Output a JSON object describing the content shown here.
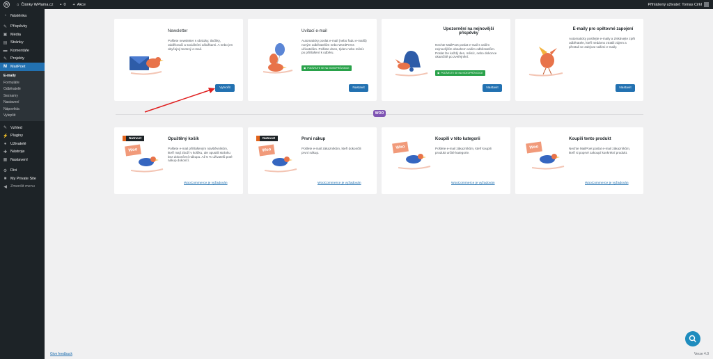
{
  "adminbar": {
    "site_name": "Články WPlama.cz",
    "comments_count": "0",
    "new_label": "Akce",
    "greeting": "Přihlášený uživatel: Tomas Cirkl"
  },
  "sidebar": {
    "items_top": [
      {
        "label": "Nástěnka",
        "icon": "dashboard-icon"
      },
      {
        "label": "Příspěvky",
        "icon": "pin-icon"
      },
      {
        "label": "Média",
        "icon": "media-icon"
      },
      {
        "label": "Stránky",
        "icon": "pages-icon"
      },
      {
        "label": "Komentáře",
        "icon": "comments-icon"
      },
      {
        "label": "Projekty",
        "icon": "pin-icon"
      },
      {
        "label": "MailPoet",
        "icon": "mailpoet-icon"
      }
    ],
    "submenu": [
      "E-maily",
      "Formuláře",
      "Odběratelé",
      "Seznamy",
      "Nastavení",
      "Nápověda",
      "Vylepšit"
    ],
    "items_bottom": [
      {
        "label": "Vzhled",
        "icon": "appearance-icon"
      },
      {
        "label": "Pluginy",
        "icon": "plugins-icon"
      },
      {
        "label": "Uživatelé",
        "icon": "users-icon"
      },
      {
        "label": "Nástroje",
        "icon": "tools-icon"
      },
      {
        "label": "Nastavení",
        "icon": "settings-icon"
      }
    ],
    "items_extra": [
      {
        "label": "Divi",
        "icon": "gear-icon"
      },
      {
        "label": "My Private Site",
        "icon": "lock-icon"
      },
      {
        "label": "Zmenšit menu",
        "icon": "collapse-icon"
      }
    ]
  },
  "cards_row1": [
    {
      "title": "Newsletter",
      "description": "Pošlete newsletter s obrázky, tlačítky, oddělovači a sociálními záložkami. A nebo jen obyčejný textový e-mail.",
      "button": "Vytvořit"
    },
    {
      "title": "Uvítací e-mail",
      "description": "Automaticky poslat e-mail (nebo řadu e-mailů) novým odběratelům nebo WordPress uživatelům. Pošlete dnes, týden nebo měsíc po přihlášení k odběru.",
      "guide": "PODÍVEJTE SE NA VIDEOPRŮVODCE",
      "button": "Nastavit"
    },
    {
      "title": "Upozornění na nejnovější příspěvky",
      "description": "Nechte MailPoet poslat e-mail s vaším nejnovějším obsahem vašim odběratelům. Poslat lze každý den, měsíc, nebo dokonce okamžitě po zveřejnění.",
      "guide": "PODÍVEJTE SE NA VIDEOPRŮVODCE",
      "button": "Nastavit"
    },
    {
      "title": "E-maily pro opětovné zapojení",
      "description": "Automaticky posílejte e-maily a získávejte zpět odběratele, kteří nedávno ztratili zájem a přestali se zabývat vašimi e-maily.",
      "button": "Nastavit"
    }
  ],
  "divider_badge": "WOO",
  "cards_row2": [
    {
      "badge": "Nutnost",
      "title": "Opuštěný košík",
      "description": "Pošlete e-mail přihlášeným návštěvníkům, kteří mají zboží v košíku, ale opustili stránku bez dokončení nákupu. Až 5 % uživatelů poté nákup dokončí.",
      "requirement": "WooCommerce je vyžadován"
    },
    {
      "badge": "Nutnost",
      "title": "První nákup",
      "description": "Pošlete e-mail zákazníkům, kteří dokončili první nákup.",
      "requirement": "WooCommerce je vyžadován"
    },
    {
      "title": "Koupili v této kategorii",
      "description": "Pošlete e-mail zákazníkům, kteří koupili produkt určité kategorie.",
      "requirement": "WooCommerce je vyžadován"
    },
    {
      "title": "Koupili tento produkt",
      "description": "Nechte MailPoet poslat e-mail zákazníkům, kteří si poprvé zakoupí konkrétní produkt.",
      "requirement": "WooCommerce je vyžadován"
    }
  ],
  "woo_logo_text": "Woo",
  "footer": {
    "feedback": "Give feedback",
    "version": "Verze 4.0"
  },
  "colors": {
    "admin_dark": "#1d2327",
    "wp_blue": "#2271b1",
    "guide_green": "#29a24a",
    "mailpoet_orange": "#e2641c",
    "annotation_arrow": "#e02020"
  }
}
